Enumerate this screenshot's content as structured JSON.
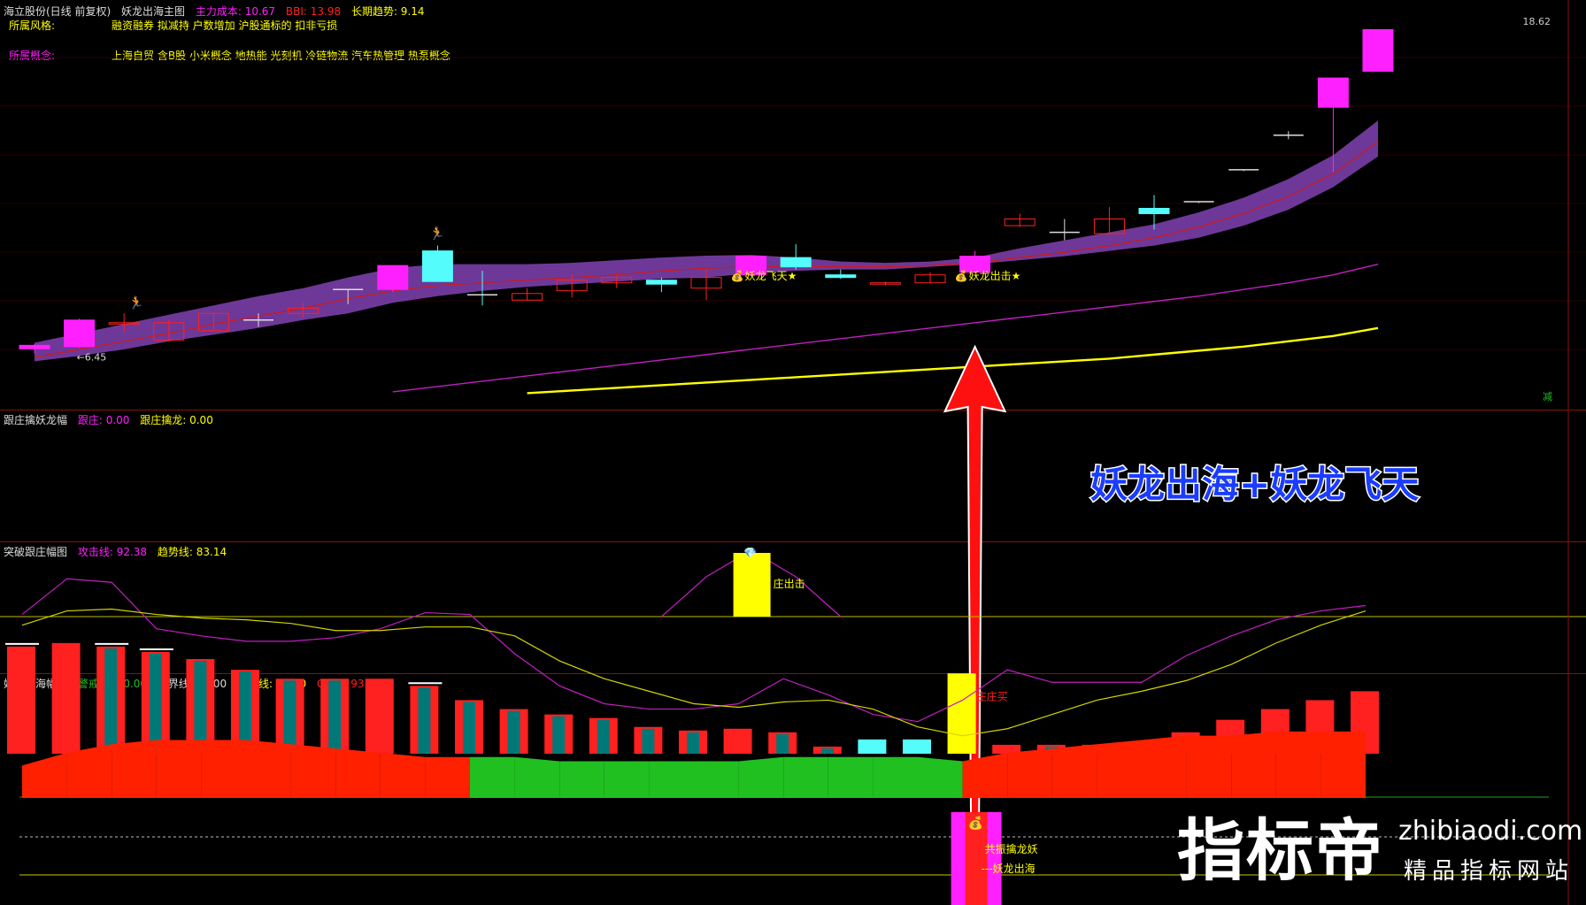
{
  "main_header": {
    "stock": "海立股份(日线 前复权)",
    "indicator": "妖龙出海主图",
    "cost_label": "主力成本: 10.67",
    "bbi_label": "BBI: 13.98",
    "trend_label": "长期趋势: 9.14"
  },
  "info": {
    "style_key": "所属风格:",
    "style_val": "融资融券 拟减持 户数增加 沪股通标的 扣非亏损",
    "concept_key": "所属概念:",
    "concept_val": "上海自贸 含B股 小米概念 地热能 光刻机 冷链物流 汽车热管理 热泵概念"
  },
  "price_top_label": "18.62",
  "low_label": "←6.45",
  "cut_label": "减",
  "signal_labels": {
    "s1": "妖龙飞天★",
    "s2": "妖龙出击★"
  },
  "annotation": "妖龙出海+妖龙飞天",
  "panel2_header": {
    "title": "跟庄擒妖龙幅",
    "a": "跟庄: 0.00",
    "b": "跟庄擒龙: 0.00"
  },
  "panel2_label": "庄出击",
  "panel3_header": {
    "title": "突破跟庄幅图",
    "a": "攻击线: 92.38",
    "b": "趋势线: 83.14"
  },
  "panel3_label": "庄庄买",
  "panel4_header": {
    "title": "妖龙出海幅图",
    "a": "警戒线: 80.00",
    "b": "分界线: 50.00",
    "c": "起涨线: 20.00",
    "d": "GF_B: 93.28"
  },
  "panel4_labels": {
    "l1": "共振擒龙妖",
    "l2": "---妖龙出海"
  },
  "logo": {
    "main": "指标帝",
    "domain": "zhibiaodi.com",
    "sub": "精品指标网站"
  },
  "colors": {
    "up": "#ff2020",
    "down": "#54fcfc",
    "magenta": "#ff20ff",
    "yellow": "#ffff00",
    "band": "#7a3ea8",
    "green": "#20c020"
  },
  "chart_data": [
    {
      "type": "candlestick",
      "title": "妖龙出海主图",
      "candles": [
        {
          "o": 6.62,
          "h": 6.8,
          "l": 6.45,
          "c": 6.75,
          "marker": "magenta"
        },
        {
          "o": 6.7,
          "h": 7.75,
          "l": 6.65,
          "c": 7.7,
          "marker": "magenta"
        },
        {
          "o": 7.55,
          "h": 7.95,
          "l": 7.25,
          "c": 7.6
        },
        {
          "o": 6.95,
          "h": 7.7,
          "l": 6.9,
          "c": 7.6
        },
        {
          "o": 7.3,
          "h": 7.95,
          "l": 7.3,
          "c": 7.95
        },
        {
          "o": 7.7,
          "h": 7.95,
          "l": 7.45,
          "c": 7.7
        },
        {
          "o": 7.95,
          "h": 8.35,
          "l": 7.8,
          "c": 8.15
        },
        {
          "o": 8.85,
          "h": 8.85,
          "l": 8.3,
          "c": 8.85
        },
        {
          "o": 8.85,
          "h": 9.35,
          "l": 8.75,
          "c": 9.75,
          "marker": "magenta"
        },
        {
          "o": 10.3,
          "h": 10.5,
          "l": 9.15,
          "c": 9.15,
          "down": true
        },
        {
          "o": 8.65,
          "h": 9.55,
          "l": 8.25,
          "c": 8.65,
          "down": true
        },
        {
          "o": 8.45,
          "h": 8.9,
          "l": 8.45,
          "c": 8.7
        },
        {
          "o": 8.8,
          "h": 9.4,
          "l": 8.55,
          "c": 9.2
        },
        {
          "o": 9.1,
          "h": 9.4,
          "l": 8.9,
          "c": 9.3
        },
        {
          "o": 9.2,
          "h": 9.3,
          "l": 8.75,
          "c": 9.05,
          "down": true
        },
        {
          "o": 8.9,
          "h": 9.6,
          "l": 8.45,
          "c": 9.3
        },
        {
          "o": 9.4,
          "h": 10.1,
          "l": 9.4,
          "c": 10.1,
          "marker": "magenta"
        },
        {
          "o": 10.05,
          "h": 10.55,
          "l": 9.6,
          "c": 9.7,
          "down": true
        },
        {
          "o": 9.4,
          "h": 9.6,
          "l": 9.25,
          "c": 9.3,
          "down": true
        },
        {
          "o": 9.05,
          "h": 9.15,
          "l": 9.0,
          "c": 9.1
        },
        {
          "o": 9.1,
          "h": 9.5,
          "l": 9.1,
          "c": 9.4
        },
        {
          "o": 9.5,
          "h": 10.3,
          "l": 9.5,
          "c": 10.1,
          "marker": "magenta"
        },
        {
          "o": 11.5,
          "h": 11.7,
          "l": 11.2,
          "c": 11.25
        },
        {
          "o": 11.0,
          "h": 11.5,
          "l": 10.7,
          "c": 11.0
        },
        {
          "o": 10.95,
          "h": 11.95,
          "l": 10.95,
          "c": 11.5
        },
        {
          "o": 11.9,
          "h": 12.4,
          "l": 11.1,
          "c": 11.7,
          "down": true
        },
        {
          "o": 12.15,
          "h": 12.15,
          "l": 12.1,
          "c": 12.15
        },
        {
          "o": 13.35,
          "h": 13.35,
          "l": 13.3,
          "c": 13.35
        },
        {
          "o": 14.65,
          "h": 14.8,
          "l": 14.5,
          "c": 14.65
        },
        {
          "o": 15.7,
          "h": 16.8,
          "l": 13.25,
          "c": 16.8,
          "marker": "magenta"
        },
        {
          "o": 17.05,
          "h": 18.62,
          "l": 17.05,
          "c": 18.62,
          "marker": "magenta"
        }
      ],
      "band_upper": [
        6.85,
        7.2,
        7.55,
        7.9,
        8.25,
        8.6,
        8.9,
        9.3,
        9.65,
        9.8,
        9.8,
        9.8,
        9.85,
        9.95,
        10.05,
        10.12,
        10.15,
        10.05,
        9.9,
        9.85,
        9.9,
        10.05,
        10.4,
        10.7,
        11.0,
        11.3,
        11.75,
        12.3,
        13.0,
        13.9,
        15.2
      ],
      "band_lower": [
        6.15,
        6.35,
        6.6,
        6.9,
        7.15,
        7.4,
        7.7,
        7.95,
        8.35,
        8.6,
        8.8,
        8.95,
        9.05,
        9.15,
        9.25,
        9.3,
        9.45,
        9.55,
        9.6,
        9.6,
        9.7,
        9.8,
        9.95,
        10.1,
        10.3,
        10.5,
        10.8,
        11.25,
        11.85,
        12.7,
        13.85
      ],
      "mid_line": [
        6.3,
        6.6,
        6.9,
        7.2,
        7.55,
        7.85,
        8.15,
        8.5,
        8.8,
        9.0,
        9.1,
        9.2,
        9.3,
        9.4,
        9.55,
        9.65,
        9.7,
        9.7,
        9.7,
        9.7,
        9.75,
        9.85,
        10.05,
        10.25,
        10.5,
        10.8,
        11.2,
        11.7,
        12.35,
        13.2,
        14.4
      ],
      "magenta_line": [
        null,
        null,
        null,
        null,
        null,
        null,
        null,
        null,
        5.0,
        5.2,
        5.4,
        5.6,
        5.8,
        6.0,
        6.2,
        6.4,
        6.6,
        6.8,
        7.0,
        7.2,
        7.4,
        7.6,
        7.8,
        8.0,
        8.2,
        8.4,
        8.6,
        8.85,
        9.1,
        9.4,
        9.8
      ],
      "yellow_line": [
        null,
        null,
        null,
        null,
        null,
        null,
        null,
        null,
        null,
        null,
        null,
        4.95,
        5.05,
        5.15,
        5.25,
        5.35,
        5.45,
        5.55,
        5.65,
        5.75,
        5.85,
        5.95,
        6.05,
        6.15,
        6.25,
        6.4,
        6.55,
        6.7,
        6.9,
        7.1,
        7.4
      ],
      "ylim": [
        4.6,
        19.4
      ]
    },
    {
      "type": "bar",
      "title": "跟庄擒妖龙幅",
      "bar_index": 16,
      "bar_value": 100,
      "curve": [
        0,
        0,
        0,
        0,
        0,
        0,
        0,
        0,
        0,
        0,
        0,
        0,
        0,
        0,
        0,
        60,
        100,
        60,
        0,
        0,
        0,
        0,
        0,
        0,
        0,
        0,
        0,
        0,
        0,
        0,
        0
      ]
    },
    {
      "type": "bar",
      "title": "突破跟庄幅图",
      "bars": [
        60,
        62,
        60,
        57,
        53,
        47,
        42,
        42,
        42,
        38,
        30,
        25,
        22,
        20,
        15,
        13,
        14,
        12,
        4,
        8,
        8,
        45,
        5,
        5,
        5,
        6,
        12,
        19,
        25,
        30,
        35
      ],
      "bar_colors": [
        "red",
        "red",
        "teal",
        "teal",
        "teal",
        "teal",
        "teal",
        "teal",
        "red",
        "teal",
        "teal",
        "teal",
        "teal",
        "teal",
        "teal",
        "teal",
        "red",
        "teal",
        "teal",
        "cyan",
        "cyan",
        "yellow",
        "red",
        "teal",
        "red",
        "red",
        "red",
        "red",
        "red",
        "red",
        "red"
      ],
      "attack_line": [
        78,
        98,
        96,
        70,
        66,
        63,
        63,
        65,
        70,
        79,
        78,
        56,
        38,
        28,
        25,
        25,
        28,
        42,
        33,
        22,
        18,
        30,
        47,
        40,
        40,
        40,
        55,
        66,
        75,
        80,
        83
      ],
      "trend_line": [
        72,
        80,
        81,
        78,
        76,
        75,
        73,
        69,
        69,
        71,
        71,
        66,
        52,
        42,
        35,
        28,
        26,
        29,
        30,
        25,
        15,
        10,
        14,
        22,
        30,
        35,
        41,
        50,
        62,
        72,
        80
      ],
      "ylim": [
        0,
        110
      ]
    },
    {
      "type": "area",
      "title": "妖龙出海幅图",
      "levels": {
        "警戒线": 80,
        "分界线": 50,
        "起涨线": 20
      },
      "gfb": [
        90,
        93,
        95,
        96,
        96,
        96,
        95,
        94,
        93,
        92,
        92,
        92,
        91,
        91,
        91,
        91,
        91,
        92,
        92,
        92,
        92,
        91,
        93,
        94,
        95,
        96,
        97,
        97,
        98,
        98,
        98
      ],
      "colors_seq": [
        "red",
        "red",
        "red",
        "red",
        "red",
        "red",
        "red",
        "red",
        "red",
        "red",
        "green",
        "green",
        "green",
        "green",
        "green",
        "green",
        "green",
        "green",
        "green",
        "green",
        "green",
        "red",
        "red",
        "red",
        "red",
        "red",
        "red",
        "red",
        "red",
        "red",
        "red"
      ],
      "signal_index": 21,
      "signal_value": 100,
      "ylim": [
        0,
        110
      ]
    }
  ]
}
